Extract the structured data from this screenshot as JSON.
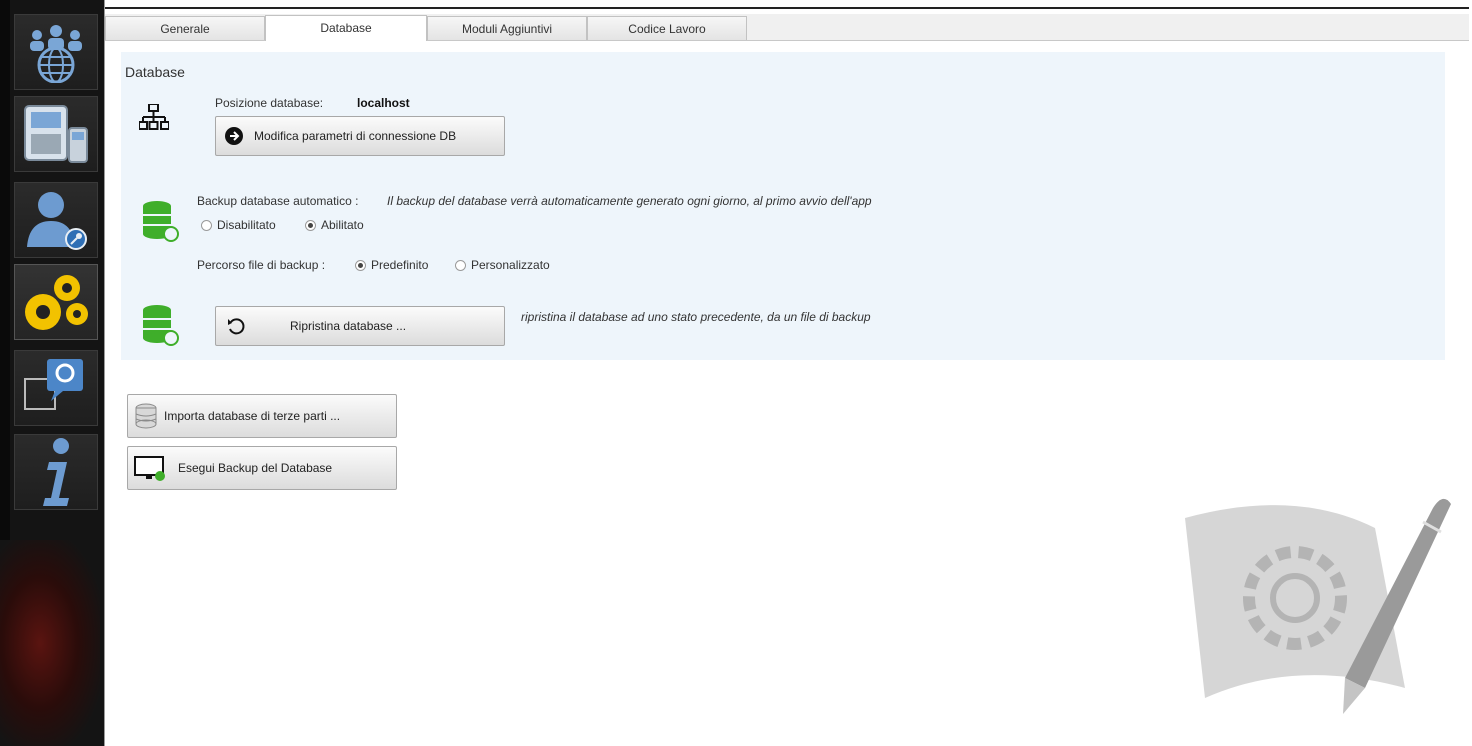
{
  "tabs": [
    {
      "label": "Generale",
      "active": false
    },
    {
      "label": "Database",
      "active": true
    },
    {
      "label": "Moduli Aggiuntivi",
      "active": false
    },
    {
      "label": "Codice Lavoro",
      "active": false
    }
  ],
  "database": {
    "section_title": "Database",
    "position_label": "Posizione database:",
    "position_value": "localhost",
    "modify_button": "Modifica parametri di connessione DB",
    "backup_label": "Backup database automatico :",
    "backup_description": "Il backup del database verrà automaticamente generato ogni giorno, al primo avvio dell'app",
    "backup_options": {
      "disabled": "Disabilitato",
      "enabled": "Abilitato",
      "selected": "Abilitato"
    },
    "path_label": "Percorso file di backup :",
    "path_options": {
      "default": "Predefinito",
      "custom": "Personalizzato",
      "selected": "Predefinito"
    },
    "restore_button": "Ripristina database ...",
    "restore_description": "ripristina il database ad uno stato precedente, da un file di backup"
  },
  "actions": {
    "import_button": "Importa database di terze parti ...",
    "backup_button": "Esegui Backup del Database"
  },
  "sidebar": {
    "items": [
      {
        "icon": "users-globe-icon"
      },
      {
        "icon": "devices-icon"
      },
      {
        "icon": "user-key-icon"
      },
      {
        "icon": "gears-icon",
        "active": true
      },
      {
        "icon": "support-chat-icon"
      },
      {
        "icon": "info-icon"
      }
    ]
  },
  "colors": {
    "sidebar_bg": "#141414",
    "panel_bg": "#eef5fb",
    "accent_blue": "#2f6fb5",
    "accent_green": "#3fae2a",
    "accent_yellow": "#f2c200"
  }
}
